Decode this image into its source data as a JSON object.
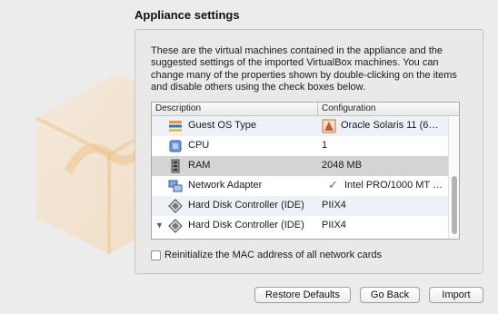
{
  "header": {
    "title": "Appliance settings"
  },
  "intro": "These are the virtual machines contained in the appliance and the suggested settings of the imported VirtualBox machines. You can change many of the properties shown by double-clicking on the items and disable others using the check boxes below.",
  "table": {
    "columns": [
      "Description",
      "Configuration"
    ],
    "rows": [
      {
        "description": "Guest OS Type",
        "configuration": "Oracle Solaris 11 (6…",
        "icon": "os-type-icon",
        "highlight": "alt"
      },
      {
        "description": "CPU",
        "configuration": "1",
        "icon": "cpu-icon",
        "highlight": "none"
      },
      {
        "description": "RAM",
        "configuration": "2048 MB",
        "icon": "ram-icon",
        "highlight": "selected"
      },
      {
        "description": "Network Adapter",
        "configuration": "Intel PRO/1000 MT …",
        "icon": "network-adapter-icon",
        "checked": true,
        "highlight": "none"
      },
      {
        "description": "Hard Disk Controller (IDE)",
        "configuration": "PIIX4",
        "icon": "disk-controller-icon",
        "highlight": "alt"
      },
      {
        "description": "Hard Disk Controller (IDE)",
        "configuration": "PIIX4",
        "icon": "disk-controller-icon",
        "expandable": true,
        "highlight": "none"
      }
    ]
  },
  "reinit_mac": {
    "label": "Reinitialize the MAC address of all network cards",
    "checked": false
  },
  "buttons": {
    "restore": "Restore Defaults",
    "back": "Go Back",
    "import": "Import"
  },
  "colors": {
    "selected_row": "#d4d4d4",
    "alt_row": "#edf2f9"
  }
}
